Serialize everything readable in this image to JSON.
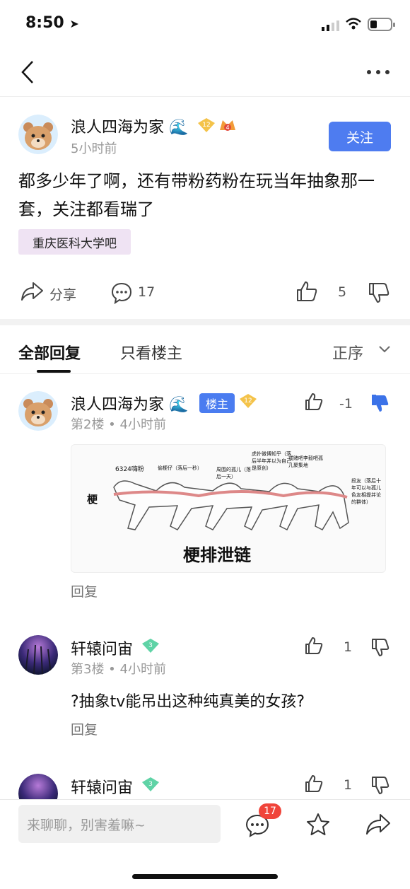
{
  "status_bar": {
    "time": "8:50"
  },
  "post": {
    "author": "浪人四海为家",
    "time": "5小时前",
    "badge_level": "12",
    "badge_small": "4",
    "follow_label": "关注",
    "text": "都多少年了啊，还有带粉药粉在玩当年抽象那一套，关注都看瑞了",
    "tag": "重庆医科大学吧",
    "share_label": "分享",
    "comment_count": "17",
    "like_count": "5"
  },
  "tabs": {
    "all": "全部回复",
    "op_only": "只看楼主",
    "sort": "正序"
  },
  "replies": [
    {
      "author": "浪人四海为家",
      "floor_badge": "楼主",
      "level": "12",
      "floor": "第2楼",
      "time": "4小时前",
      "likes": "-1",
      "reply_label": "回复",
      "image": {
        "title": "梗排泄链",
        "labels": [
          "6324嗨粉",
          "偷梗仔（落后一秒）",
          "周围的孤儿（落后一天）",
          "虎扑微博知乎（落后半年并以为自己是原创）",
          "戒赌吧李毅吧孤儿聚集地",
          "段友（落后十年可以与孤儿色友相提并论的群体）"
        ],
        "arrow_label": "梗"
      }
    },
    {
      "author": "轩辕问宙",
      "level": "3",
      "floor": "第3楼",
      "time": "4小时前",
      "likes": "1",
      "text": "?抽象tv能吊出这种纯真美的女孩?",
      "reply_label": "回复"
    },
    {
      "author": "轩辕问宙",
      "level": "3",
      "likes": "1"
    }
  ],
  "bottom_bar": {
    "placeholder": "来聊聊，别害羞嘛~",
    "message_badge": "17"
  },
  "colors": {
    "accent": "#4e7cf0",
    "tag_bg": "#efe3f3"
  }
}
